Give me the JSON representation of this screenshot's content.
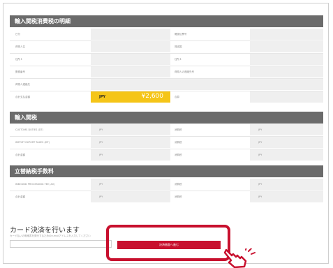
{
  "section1": {
    "title": "輸入関税消費税の明細",
    "rows": [
      {
        "l": "日付",
        "r": "確認伝票号"
      },
      {
        "l": "荷物人名",
        "r": "発送国"
      },
      {
        "l": "住所１",
        "r": "住所１"
      },
      {
        "l": "郵便番号",
        "r": "荷物人の連絡先号"
      },
      {
        "l": "荷物人連絡先"
      },
      {
        "l": "合計支払金額",
        "r": "合算",
        "currency": "JPY",
        "amount": "¥2,600"
      }
    ]
  },
  "section2": {
    "title": "輸入関税",
    "rows": [
      {
        "l": "CUSTOMS DUTIES (DT)",
        "v1": "JPY",
        "r": "消費税",
        "v2": "JPY"
      },
      {
        "l": "IMPORT EXPORT TAXES (DT)",
        "v1": "JPY",
        "r": "消費税",
        "v2": "JPY"
      },
      {
        "l": "合計金額",
        "v1": "JPY",
        "r": "消費税",
        "v2": "JPY"
      }
    ]
  },
  "section3": {
    "title": "立替納税手数料",
    "rows": [
      {
        "l": "INBOUND PROCESSING FEE (AV)",
        "v1": "JPY",
        "r": "消費税",
        "v2": "JPY"
      },
      {
        "l": "合計金額",
        "v1": "JPY",
        "r": "消費税",
        "v2": "JPY"
      }
    ]
  },
  "card": {
    "title": "カード決済を行います",
    "note": "カード払いの明細書を発行するためのe-mailアドレスを入力してください",
    "email_value": "",
    "pay_button": "決済画面へ進む"
  },
  "colors": {
    "accent": "#c8102e",
    "highlight": "#f5c518",
    "header": "#6b6b6b"
  }
}
